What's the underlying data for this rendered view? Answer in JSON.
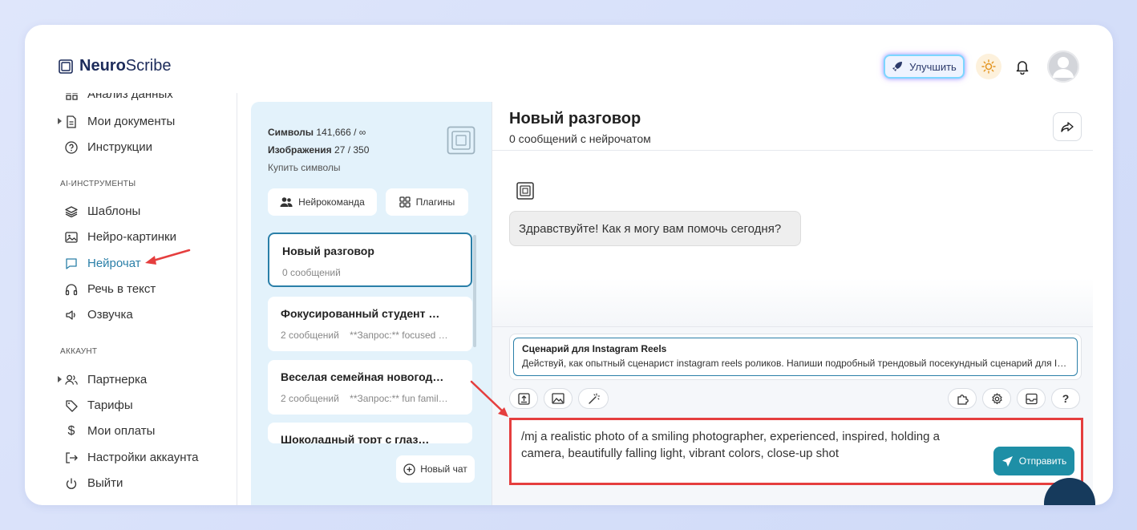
{
  "app": {
    "logo_bold": "Neuro",
    "logo_rest": "Scribe"
  },
  "header": {
    "upgrade_label": "Улучшить"
  },
  "sidebar": {
    "items_top": [
      {
        "label": "Анализ данных",
        "icon": "grid-icon"
      },
      {
        "label": "Мои документы",
        "icon": "document-icon"
      },
      {
        "label": "Инструкции",
        "icon": "help-circle-icon"
      }
    ],
    "section_ai": "AI-ИНСТРУМЕНТЫ",
    "items_ai": [
      {
        "label": "Шаблоны",
        "icon": "layers-icon"
      },
      {
        "label": "Нейро-картинки",
        "icon": "image-icon"
      },
      {
        "label": "Нейрочат",
        "icon": "chat-icon"
      },
      {
        "label": "Речь в текст",
        "icon": "headphones-icon"
      },
      {
        "label": "Озвучка",
        "icon": "speaker-icon"
      }
    ],
    "section_account": "АККАУНТ",
    "items_account": [
      {
        "label": "Партнерка",
        "icon": "users-icon"
      },
      {
        "label": "Тарифы",
        "icon": "tag-icon"
      },
      {
        "label": "Мои оплаты",
        "icon": "dollar-icon"
      },
      {
        "label": "Настройки аккаунта",
        "icon": "settings-arrow-icon"
      },
      {
        "label": "Выйти",
        "icon": "power-icon"
      }
    ]
  },
  "list_panel": {
    "symbols_label": "Символы",
    "symbols_value": "141,666 / ∞",
    "images_label": "Изображения",
    "images_value": "27 / 350",
    "buy_label": "Купить символы",
    "team_button": "Нейрокоманда",
    "plugins_button": "Плагины",
    "chats": [
      {
        "title": "Новый разговор",
        "count": "0 сообщений",
        "preview": ""
      },
      {
        "title": "Фокусированный студент …",
        "count": "2 сообщений",
        "preview": "**Запрос:** focused …"
      },
      {
        "title": "Веселая семейная новогод…",
        "count": "2 сообщений",
        "preview": "**Запрос:** fun famil…"
      },
      {
        "title": "Шоколадный торт с глаз…",
        "count": "",
        "preview": ""
      }
    ],
    "new_chat_button": "Новый чат"
  },
  "chat": {
    "title": "Новый разговор",
    "subtitle": "0 сообщений с нейрочатом",
    "greeting": "Здравствуйте! Как я могу вам помочь сегодня?",
    "prompt_title": "Сценарий для Instagram Reels",
    "prompt_text": "Действуй, как опытный сценарист instagram reels роликов. Напиши подробный трендовый посекундный сценарий для Instagram Reels",
    "input_value": "/mj a realistic photo of a smiling photographer, experienced, inspired, holding a camera, beautifully falling light, vibrant colors, close-up shot",
    "send_label": "Отправить",
    "help_label": "?"
  },
  "colors": {
    "accent": "#2a7fa8",
    "send": "#1e8fa6",
    "highlight": "#e53e3e"
  }
}
